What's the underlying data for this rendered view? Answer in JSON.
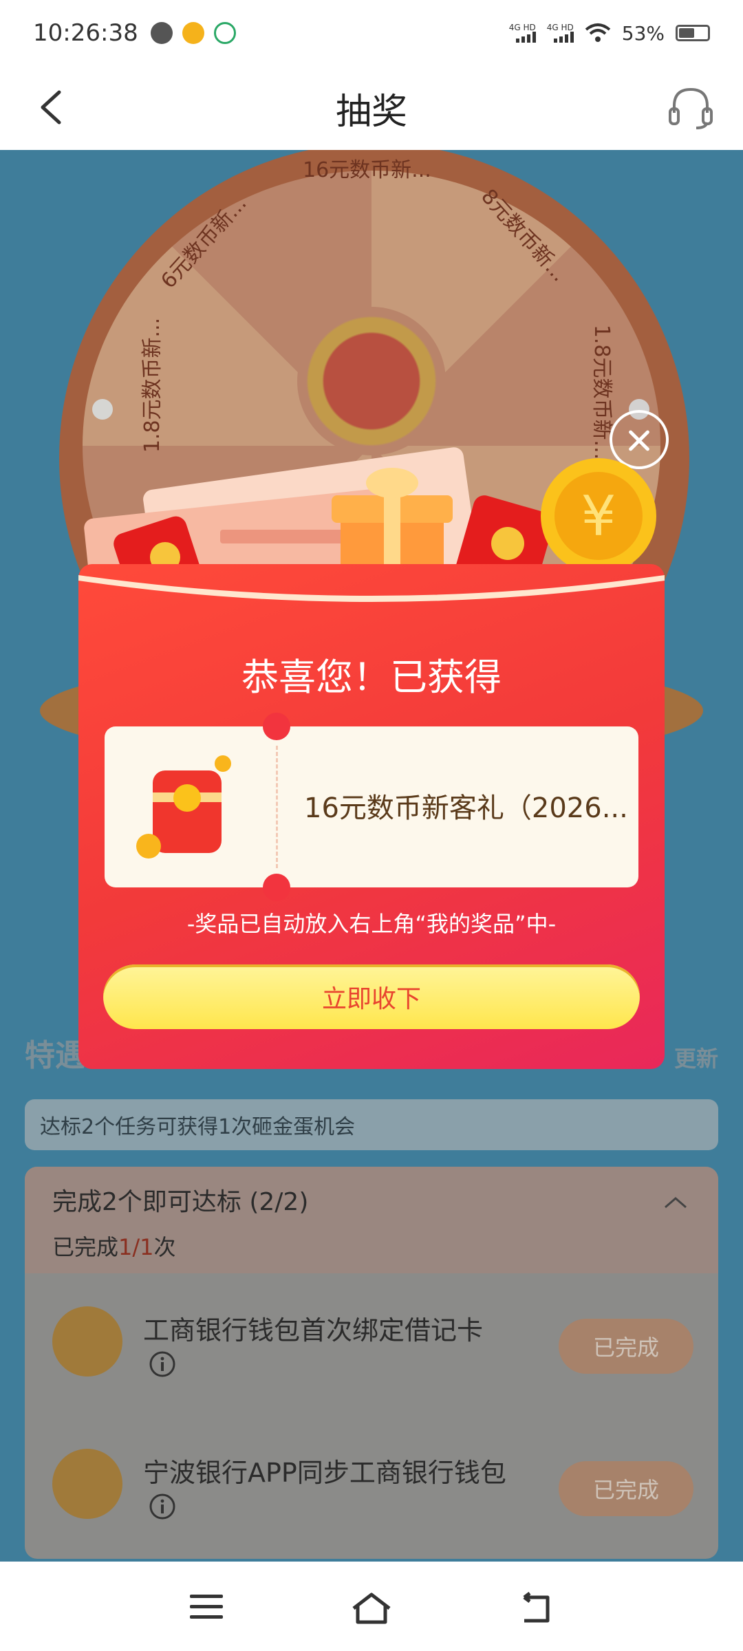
{
  "status_bar": {
    "time": "10:26:38",
    "network_1": "4G HD",
    "network_2": "4G HD",
    "battery": "53%"
  },
  "nav": {
    "title": "抽奖"
  },
  "wheel": {
    "segments": [
      "16元数币新...",
      "8元数币新...",
      "1.8元数币新...",
      "6元数币新...",
      "1.8元数币新..."
    ]
  },
  "tasks": {
    "section_title": "特遇地现成数币任务",
    "refresh": "更新",
    "hint": "达标2个任务可获得1次砸金蛋机会",
    "card_title": "完成2个即可达标 (2/2)",
    "progress_prefix": "已完成",
    "progress_value": "1/1",
    "progress_suffix": "次",
    "items": [
      {
        "name": "工商银行钱包首次绑定借记卡",
        "status": "已完成"
      },
      {
        "name": "宁波银行APP同步工商银行钱包",
        "status": "已完成"
      }
    ]
  },
  "modal": {
    "title": "恭喜您！已获得",
    "prize_name": "16元数币新客礼（2026...",
    "note": "-奖品已自动放入右上角“我的奖品”中-",
    "accept_label": "立即收下"
  },
  "colors": {
    "modal_red": "#f23a3a",
    "button_yellow": "#ffe64d",
    "overlay_bg": "#3f7d9a"
  }
}
